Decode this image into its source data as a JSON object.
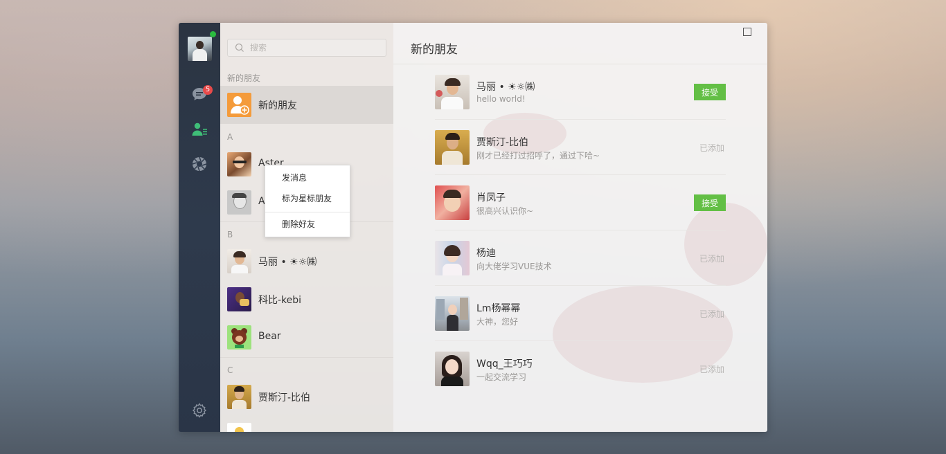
{
  "search": {
    "placeholder": "搜索"
  },
  "nav": {
    "unread_count": "5"
  },
  "list": {
    "section_new": "新的朋友",
    "new_friend_label": "新的朋友",
    "groups": [
      {
        "letter": "A",
        "items": [
          "Aster",
          "A"
        ]
      },
      {
        "letter": "B",
        "items": [
          "马丽 • ☀☼㈱",
          "科比-kebi",
          "Bear"
        ]
      },
      {
        "letter": "C",
        "items": [
          "贾斯汀-比伯"
        ]
      }
    ]
  },
  "context_menu": {
    "send_message": "发消息",
    "star_friend": "标为星标朋友",
    "delete_friend": "删除好友"
  },
  "main": {
    "title": "新的朋友",
    "requests": [
      {
        "name": "马丽 • ☀☼㈱",
        "message": "hello world!",
        "status": "接受"
      },
      {
        "name": "贾斯汀-比伯",
        "message": "刚才已经打过招呼了，通过下哈~",
        "status": "已添加"
      },
      {
        "name": "肖凤子",
        "message": "很高兴认识你~",
        "status": "接受"
      },
      {
        "name": "杨迪",
        "message": "向大佬学习VUE技术",
        "status": "已添加"
      },
      {
        "name": "Lm杨幂幂",
        "message": "大神，您好",
        "status": "已添加"
      },
      {
        "name": "Wqq_王巧巧",
        "message": "一起交流学习",
        "status": "已添加"
      }
    ]
  },
  "colors": {
    "accept_green": "#63bf45",
    "nav_bg": "#2b3442",
    "badge_red": "#e84a4a",
    "online_green": "#2bbb3f",
    "new_friend_orange": "#f49b3b"
  },
  "icons": [
    "chat-icon",
    "contacts-icon",
    "moments-icon",
    "settings-icon",
    "search-icon",
    "add-friend-icon",
    "maximize-icon"
  ]
}
